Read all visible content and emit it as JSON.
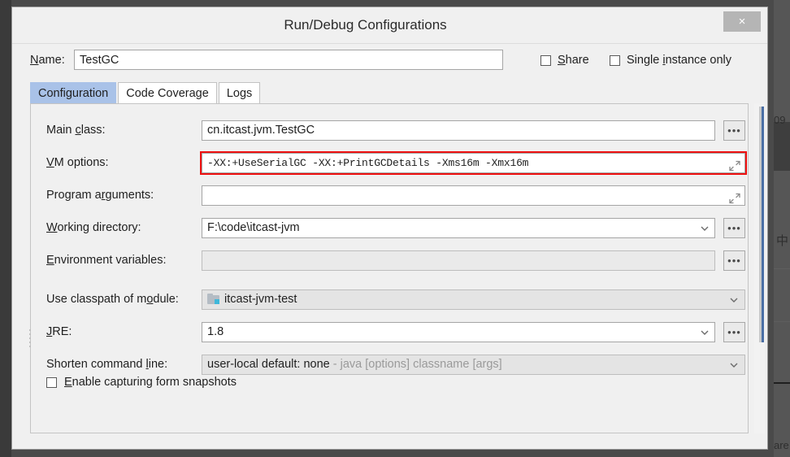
{
  "window": {
    "title": "Run/Debug Configurations",
    "close_label": "×"
  },
  "name_row": {
    "label_pre": "",
    "label_mn": "N",
    "label_post": "ame:",
    "value": "TestGC",
    "placeholder": "",
    "share": {
      "pre": "",
      "mn": "S",
      "post": "hare",
      "checked": false
    },
    "single_instance": {
      "pre": "Single ",
      "mn": "i",
      "post": "nstance only",
      "checked": false
    }
  },
  "tabs": [
    {
      "label": "Configuration",
      "active": true
    },
    {
      "label": "Code Coverage",
      "active": false
    },
    {
      "label": "Logs",
      "active": false
    }
  ],
  "fields": {
    "main_class": {
      "label_pre": "Main ",
      "label_mn": "c",
      "label_post": "lass:",
      "value": "cn.itcast.jvm.TestGC",
      "browse_label": "•••"
    },
    "vm_options": {
      "label_pre": "",
      "label_mn": "V",
      "label_post": "M options:",
      "value": "-XX:+UseSerialGC -XX:+PrintGCDetails -Xms16m -Xmx16m",
      "highlight_color": "#ee1111",
      "expand_icon": "expand-icon"
    },
    "program_arguments": {
      "label_pre": "Program a",
      "label_mn": "r",
      "label_post": "guments:",
      "value": "",
      "expand_icon": "expand-icon"
    },
    "working_directory": {
      "label_pre": "",
      "label_mn": "W",
      "label_post": "orking directory:",
      "value": "F:\\code\\itcast-jvm",
      "browse_label": "•••"
    },
    "environment_variables": {
      "label_pre": "",
      "label_mn": "E",
      "label_post": "nvironment variables:",
      "value": "",
      "browse_label": "•••",
      "disabled": true
    },
    "use_classpath_of_module": {
      "label_pre": "Use classpath of m",
      "label_mn": "o",
      "label_post": "dule:",
      "value": "itcast-jvm-test",
      "icon": "module-icon"
    },
    "jre": {
      "label_pre": "",
      "label_mn": "J",
      "label_post": "RE:",
      "value": "1.8",
      "browse_label": "•••"
    },
    "shorten_command_line": {
      "label_pre": "Shorten command ",
      "label_mn": "l",
      "label_post": "ine:",
      "value": "user-local default: none",
      "value_hint": " - java [options] classname [args]"
    }
  },
  "form_snapshots": {
    "pre": "",
    "mn": "E",
    "post": "nable capturing form snapshots",
    "checked": false
  },
  "background": {
    "fragment_top_right": "09",
    "fragment_mid_right": "中",
    "fragment_bottom_right": "are"
  }
}
